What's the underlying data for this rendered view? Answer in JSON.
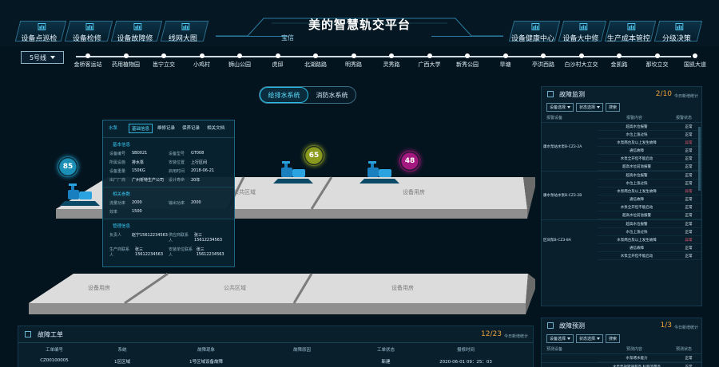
{
  "header": {
    "title": "美的智慧轨交平台",
    "brand": "宝信",
    "nav_left": [
      "设备点巡检",
      "设备检修",
      "设备故障修",
      "线网大图"
    ],
    "nav_right": [
      "设备健康中心",
      "设备大中修",
      "生产成本管控",
      "分级决策"
    ]
  },
  "line_selector": {
    "value": "5号线"
  },
  "stations": [
    "金桥客运站",
    "药用植物园",
    "邕宁立交",
    "小鸡村",
    "狮山公园",
    "虎邱",
    "北湖路路",
    "明秀路",
    "灵秀路",
    "广西大学",
    "新秀公园",
    "旱塘",
    "亭洪西路",
    "白沙村大立交",
    "金凯路",
    "那坎立交",
    "国凯大道"
  ],
  "toggle": {
    "options": [
      "给排水系统",
      "消防水系统"
    ],
    "active": 0
  },
  "scene": {
    "top_areas": [
      "公共区域",
      "设备用房"
    ],
    "bottom_areas": [
      "设备用房",
      "公共区域",
      "设备用房"
    ],
    "gauges": [
      {
        "value": "85",
        "color": "#1b8fb5"
      },
      {
        "value": "65",
        "color": "#8a9a1e"
      },
      {
        "value": "48",
        "color": "#a3197f"
      }
    ]
  },
  "popup": {
    "tabs": [
      "水泵",
      "基础信息",
      "维修记录",
      "保养记录",
      "相关文档"
    ],
    "active_tab": 1,
    "basic_title": "基本信息",
    "basic": [
      {
        "k1": "设备编号",
        "v1": "SB0021",
        "k2": "设备型号",
        "v2": "GT008"
      },
      {
        "k1": "所属设施",
        "v1": "排水泵",
        "k2": "安装位置",
        "v2": "上行区间"
      },
      {
        "k1": "设备重量",
        "v1": "150KG",
        "k2": "启用时间",
        "v2": "2018-06-21"
      },
      {
        "k1": "出厂厂商",
        "v1": "广州祈特生产公司",
        "k2": "设计寿命",
        "v2": "20年"
      }
    ],
    "params_title": "相关参数",
    "params": [
      {
        "k1": "流量功率",
        "v1": "2000",
        "k2": "输出功率",
        "v2": "2000"
      },
      {
        "k1": "效率",
        "v1": "1500",
        "k2": "",
        "v2": ""
      }
    ],
    "mgmt_title": "管理信息",
    "mgmt": [
      {
        "k1": "负责人",
        "v1": "赵宁15612234563",
        "k2": "供应商联系人",
        "v2": "张三15612234563"
      },
      {
        "k1": "生产商联系人",
        "v1": "张三15612234563",
        "k2": "安装单位联系人",
        "v2": "张三15612234563"
      }
    ]
  },
  "fault_monitor": {
    "title": "故障监测",
    "count": "2/10",
    "more": "今日新增统计",
    "filters": [
      "设备选择",
      "状态选择"
    ],
    "search": "搜索",
    "columns": [
      "报警设备",
      "报警内容",
      "报警状态"
    ],
    "groups": [
      {
        "name": "康水泵站水泵B-CZ3-2A",
        "items": [
          {
            "reason": "超高水位报警",
            "status": "正常",
            "bad": false
          },
          {
            "reason": "水位上涨过快",
            "status": "正常",
            "bad": false
          },
          {
            "reason": "水泵两台及以上发生故障",
            "status": "异常",
            "bad": true
          },
          {
            "reason": "通信故障",
            "status": "正常",
            "bad": false
          },
          {
            "reason": "水泵全开但不能启动",
            "status": "正常",
            "bad": false
          },
          {
            "reason": "超高水位前溢报警",
            "status": "正常",
            "bad": false
          }
        ]
      },
      {
        "name": "康水泵站水泵B-CZ3-2B",
        "items": [
          {
            "reason": "超高水位报警",
            "status": "正常",
            "bad": false
          },
          {
            "reason": "水位上涨过快",
            "status": "正常",
            "bad": false
          },
          {
            "reason": "水泵两台及以上发生故障",
            "status": "异常",
            "bad": true
          },
          {
            "reason": "通信故障",
            "status": "正常",
            "bad": false
          },
          {
            "reason": "水泵全开但不能启动",
            "status": "正常",
            "bad": false
          },
          {
            "reason": "超高水位前溢报警",
            "status": "正常",
            "bad": false
          }
        ]
      },
      {
        "name": "区间泵B-CZ3-8A",
        "items": [
          {
            "reason": "超高水位报警",
            "status": "正常",
            "bad": false
          },
          {
            "reason": "水位上涨过快",
            "status": "正常",
            "bad": false
          },
          {
            "reason": "水泵两台及以上发生故障",
            "status": "异常",
            "bad": true
          },
          {
            "reason": "通信故障",
            "status": "正常",
            "bad": false
          },
          {
            "reason": "水泵全开但不能启动",
            "status": "正常",
            "bad": false
          }
        ]
      }
    ]
  },
  "fault_predict": {
    "title": "故障预测",
    "count": "1/3",
    "more": "今日新增统计",
    "filters": [
      "设备选择",
      "状态选择"
    ],
    "search": "搜索",
    "columns": [
      "预测设备",
      "预测内容",
      "预测状态"
    ],
    "rows": [
      {
        "reason": "水泵堵水能力",
        "status": "正常"
      },
      {
        "reason": "水泵泵效转速超高,标称流量高",
        "status": "正常"
      }
    ]
  },
  "work_orders": {
    "title": "故障工单",
    "count": "12/23",
    "more": "今日新增统计",
    "columns": [
      "工单编号",
      "系统",
      "故障现象",
      "故障原因",
      "工单状态",
      "报修时间"
    ],
    "row": [
      "CZ00100005",
      "1区区域",
      "1号区域设备故障",
      "",
      "新建",
      "2020-06-01 09：25：03"
    ]
  }
}
